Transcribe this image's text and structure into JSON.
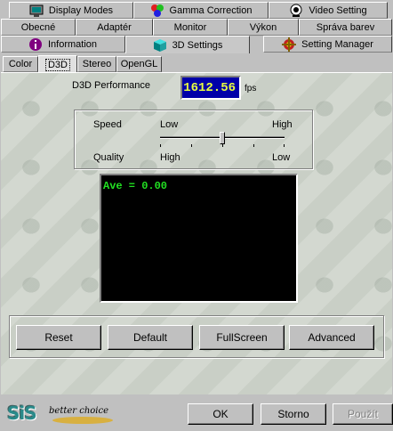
{
  "tabs": {
    "row1": [
      {
        "label": "Display Modes",
        "icon": "monitor-icon"
      },
      {
        "label": "Gamma Correction",
        "icon": "color-wheel-icon"
      },
      {
        "label": "Video Setting",
        "icon": "video-icon"
      }
    ],
    "row2": [
      "Obecné",
      "Adaptér",
      "Monitor",
      "Výkon",
      "Správa barev"
    ],
    "row3": [
      {
        "label": "Information",
        "icon": "info-icon"
      },
      {
        "label": "3D Settings",
        "icon": "cube-icon"
      },
      {
        "label": "Setting Manager",
        "icon": "gear-icon"
      }
    ]
  },
  "subtabs": [
    "Color",
    "D3D",
    "Stereo",
    "OpenGL"
  ],
  "performance": {
    "label": "D3D Performance",
    "value": "1612.56",
    "unit": "fps"
  },
  "slider": {
    "speed_label": "Speed",
    "quality_label": "Quality",
    "speed_low": "Low",
    "speed_high": "High",
    "quality_high": "High",
    "quality_low": "Low",
    "position": 0.5
  },
  "display": {
    "text": "Ave =  0.00"
  },
  "buttons": {
    "reset": "Reset",
    "default": "Default",
    "fullscreen": "FullScreen",
    "advanced": "Advanced"
  },
  "footer": {
    "logo": "SiS",
    "slogan": "better choice",
    "ok": "OK",
    "cancel": "Storno",
    "apply": "Použít"
  },
  "colors": {
    "perf_bg": "#0000a8",
    "perf_text": "#e8ff40",
    "display_text": "#22e022"
  }
}
